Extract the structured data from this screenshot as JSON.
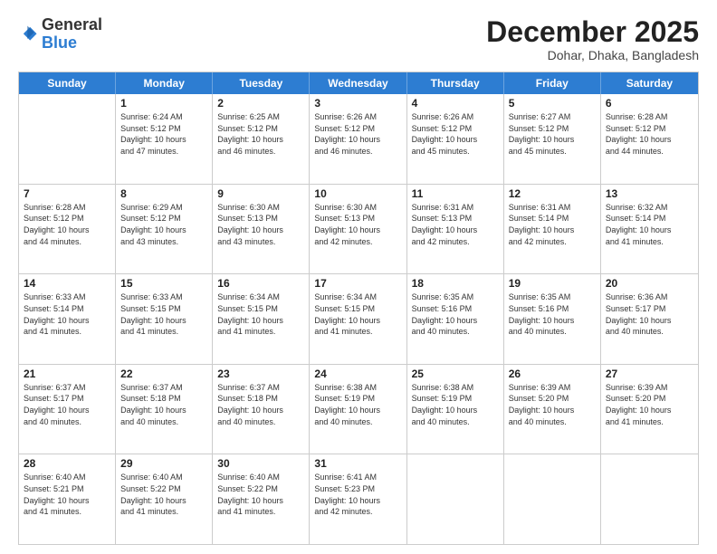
{
  "logo": {
    "general": "General",
    "blue": "Blue"
  },
  "header": {
    "month": "December 2025",
    "location": "Dohar, Dhaka, Bangladesh"
  },
  "days": [
    "Sunday",
    "Monday",
    "Tuesday",
    "Wednesday",
    "Thursday",
    "Friday",
    "Saturday"
  ],
  "rows": [
    [
      {
        "day": "",
        "info": ""
      },
      {
        "day": "1",
        "info": "Sunrise: 6:24 AM\nSunset: 5:12 PM\nDaylight: 10 hours\nand 47 minutes."
      },
      {
        "day": "2",
        "info": "Sunrise: 6:25 AM\nSunset: 5:12 PM\nDaylight: 10 hours\nand 46 minutes."
      },
      {
        "day": "3",
        "info": "Sunrise: 6:26 AM\nSunset: 5:12 PM\nDaylight: 10 hours\nand 46 minutes."
      },
      {
        "day": "4",
        "info": "Sunrise: 6:26 AM\nSunset: 5:12 PM\nDaylight: 10 hours\nand 45 minutes."
      },
      {
        "day": "5",
        "info": "Sunrise: 6:27 AM\nSunset: 5:12 PM\nDaylight: 10 hours\nand 45 minutes."
      },
      {
        "day": "6",
        "info": "Sunrise: 6:28 AM\nSunset: 5:12 PM\nDaylight: 10 hours\nand 44 minutes."
      }
    ],
    [
      {
        "day": "7",
        "info": "Sunrise: 6:28 AM\nSunset: 5:12 PM\nDaylight: 10 hours\nand 44 minutes."
      },
      {
        "day": "8",
        "info": "Sunrise: 6:29 AM\nSunset: 5:12 PM\nDaylight: 10 hours\nand 43 minutes."
      },
      {
        "day": "9",
        "info": "Sunrise: 6:30 AM\nSunset: 5:13 PM\nDaylight: 10 hours\nand 43 minutes."
      },
      {
        "day": "10",
        "info": "Sunrise: 6:30 AM\nSunset: 5:13 PM\nDaylight: 10 hours\nand 42 minutes."
      },
      {
        "day": "11",
        "info": "Sunrise: 6:31 AM\nSunset: 5:13 PM\nDaylight: 10 hours\nand 42 minutes."
      },
      {
        "day": "12",
        "info": "Sunrise: 6:31 AM\nSunset: 5:14 PM\nDaylight: 10 hours\nand 42 minutes."
      },
      {
        "day": "13",
        "info": "Sunrise: 6:32 AM\nSunset: 5:14 PM\nDaylight: 10 hours\nand 41 minutes."
      }
    ],
    [
      {
        "day": "14",
        "info": "Sunrise: 6:33 AM\nSunset: 5:14 PM\nDaylight: 10 hours\nand 41 minutes."
      },
      {
        "day": "15",
        "info": "Sunrise: 6:33 AM\nSunset: 5:15 PM\nDaylight: 10 hours\nand 41 minutes."
      },
      {
        "day": "16",
        "info": "Sunrise: 6:34 AM\nSunset: 5:15 PM\nDaylight: 10 hours\nand 41 minutes."
      },
      {
        "day": "17",
        "info": "Sunrise: 6:34 AM\nSunset: 5:15 PM\nDaylight: 10 hours\nand 41 minutes."
      },
      {
        "day": "18",
        "info": "Sunrise: 6:35 AM\nSunset: 5:16 PM\nDaylight: 10 hours\nand 40 minutes."
      },
      {
        "day": "19",
        "info": "Sunrise: 6:35 AM\nSunset: 5:16 PM\nDaylight: 10 hours\nand 40 minutes."
      },
      {
        "day": "20",
        "info": "Sunrise: 6:36 AM\nSunset: 5:17 PM\nDaylight: 10 hours\nand 40 minutes."
      }
    ],
    [
      {
        "day": "21",
        "info": "Sunrise: 6:37 AM\nSunset: 5:17 PM\nDaylight: 10 hours\nand 40 minutes."
      },
      {
        "day": "22",
        "info": "Sunrise: 6:37 AM\nSunset: 5:18 PM\nDaylight: 10 hours\nand 40 minutes."
      },
      {
        "day": "23",
        "info": "Sunrise: 6:37 AM\nSunset: 5:18 PM\nDaylight: 10 hours\nand 40 minutes."
      },
      {
        "day": "24",
        "info": "Sunrise: 6:38 AM\nSunset: 5:19 PM\nDaylight: 10 hours\nand 40 minutes."
      },
      {
        "day": "25",
        "info": "Sunrise: 6:38 AM\nSunset: 5:19 PM\nDaylight: 10 hours\nand 40 minutes."
      },
      {
        "day": "26",
        "info": "Sunrise: 6:39 AM\nSunset: 5:20 PM\nDaylight: 10 hours\nand 40 minutes."
      },
      {
        "day": "27",
        "info": "Sunrise: 6:39 AM\nSunset: 5:20 PM\nDaylight: 10 hours\nand 41 minutes."
      }
    ],
    [
      {
        "day": "28",
        "info": "Sunrise: 6:40 AM\nSunset: 5:21 PM\nDaylight: 10 hours\nand 41 minutes."
      },
      {
        "day": "29",
        "info": "Sunrise: 6:40 AM\nSunset: 5:22 PM\nDaylight: 10 hours\nand 41 minutes."
      },
      {
        "day": "30",
        "info": "Sunrise: 6:40 AM\nSunset: 5:22 PM\nDaylight: 10 hours\nand 41 minutes."
      },
      {
        "day": "31",
        "info": "Sunrise: 6:41 AM\nSunset: 5:23 PM\nDaylight: 10 hours\nand 42 minutes."
      },
      {
        "day": "",
        "info": ""
      },
      {
        "day": "",
        "info": ""
      },
      {
        "day": "",
        "info": ""
      }
    ]
  ]
}
